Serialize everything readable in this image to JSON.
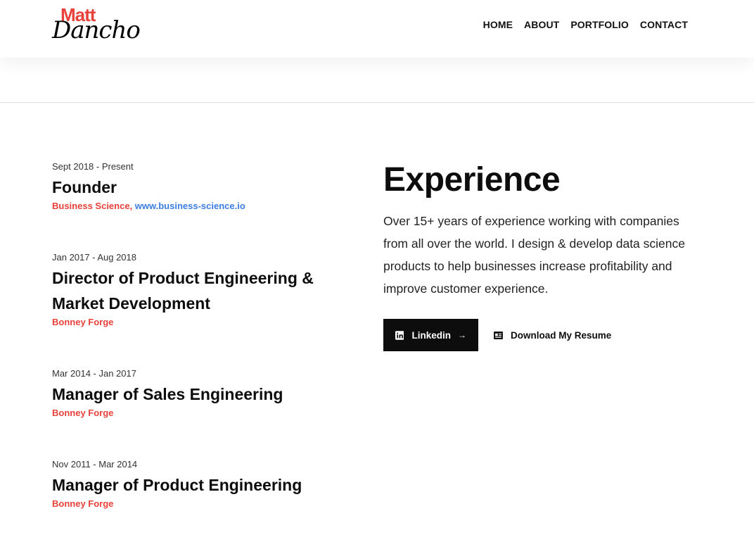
{
  "brand": {
    "logo_top": "Matt",
    "logo_bottom": "Dancho",
    "accent_color": "#e8413b",
    "link_color": "#3b7de0"
  },
  "nav": {
    "items": [
      "HOME",
      "ABOUT",
      "PORTFOLIO",
      "CONTACT"
    ]
  },
  "experience": {
    "title": "Experience",
    "description": "Over 15+ years of experience working with companies from all over the world. I design & develop data science products to help businesses increase profitability and improve customer experience.",
    "linkedin_label": "Linkedin",
    "linkedin_icon": "linkedin-icon",
    "arrow_icon": "arrow-right-icon",
    "resume_label": "Download My Resume",
    "resume_icon": "document-icon"
  },
  "jobs": [
    {
      "dates": "Sept 2018 - Present",
      "title": "Founder",
      "company": "Business Science, ",
      "link": "www.business-science.io"
    },
    {
      "dates": "Jan 2017 - Aug 2018",
      "title_line1": "Director of Product Engineering &",
      "title_line2": "Market Development",
      "company": "Bonney Forge"
    },
    {
      "dates": "Mar 2014 - Jan 2017",
      "title": "Manager of Sales Engineering",
      "company": "Bonney Forge"
    },
    {
      "dates": "Nov 2011 - Mar 2014",
      "title": "Manager of Product Engineering",
      "company": "Bonney Forge"
    }
  ]
}
